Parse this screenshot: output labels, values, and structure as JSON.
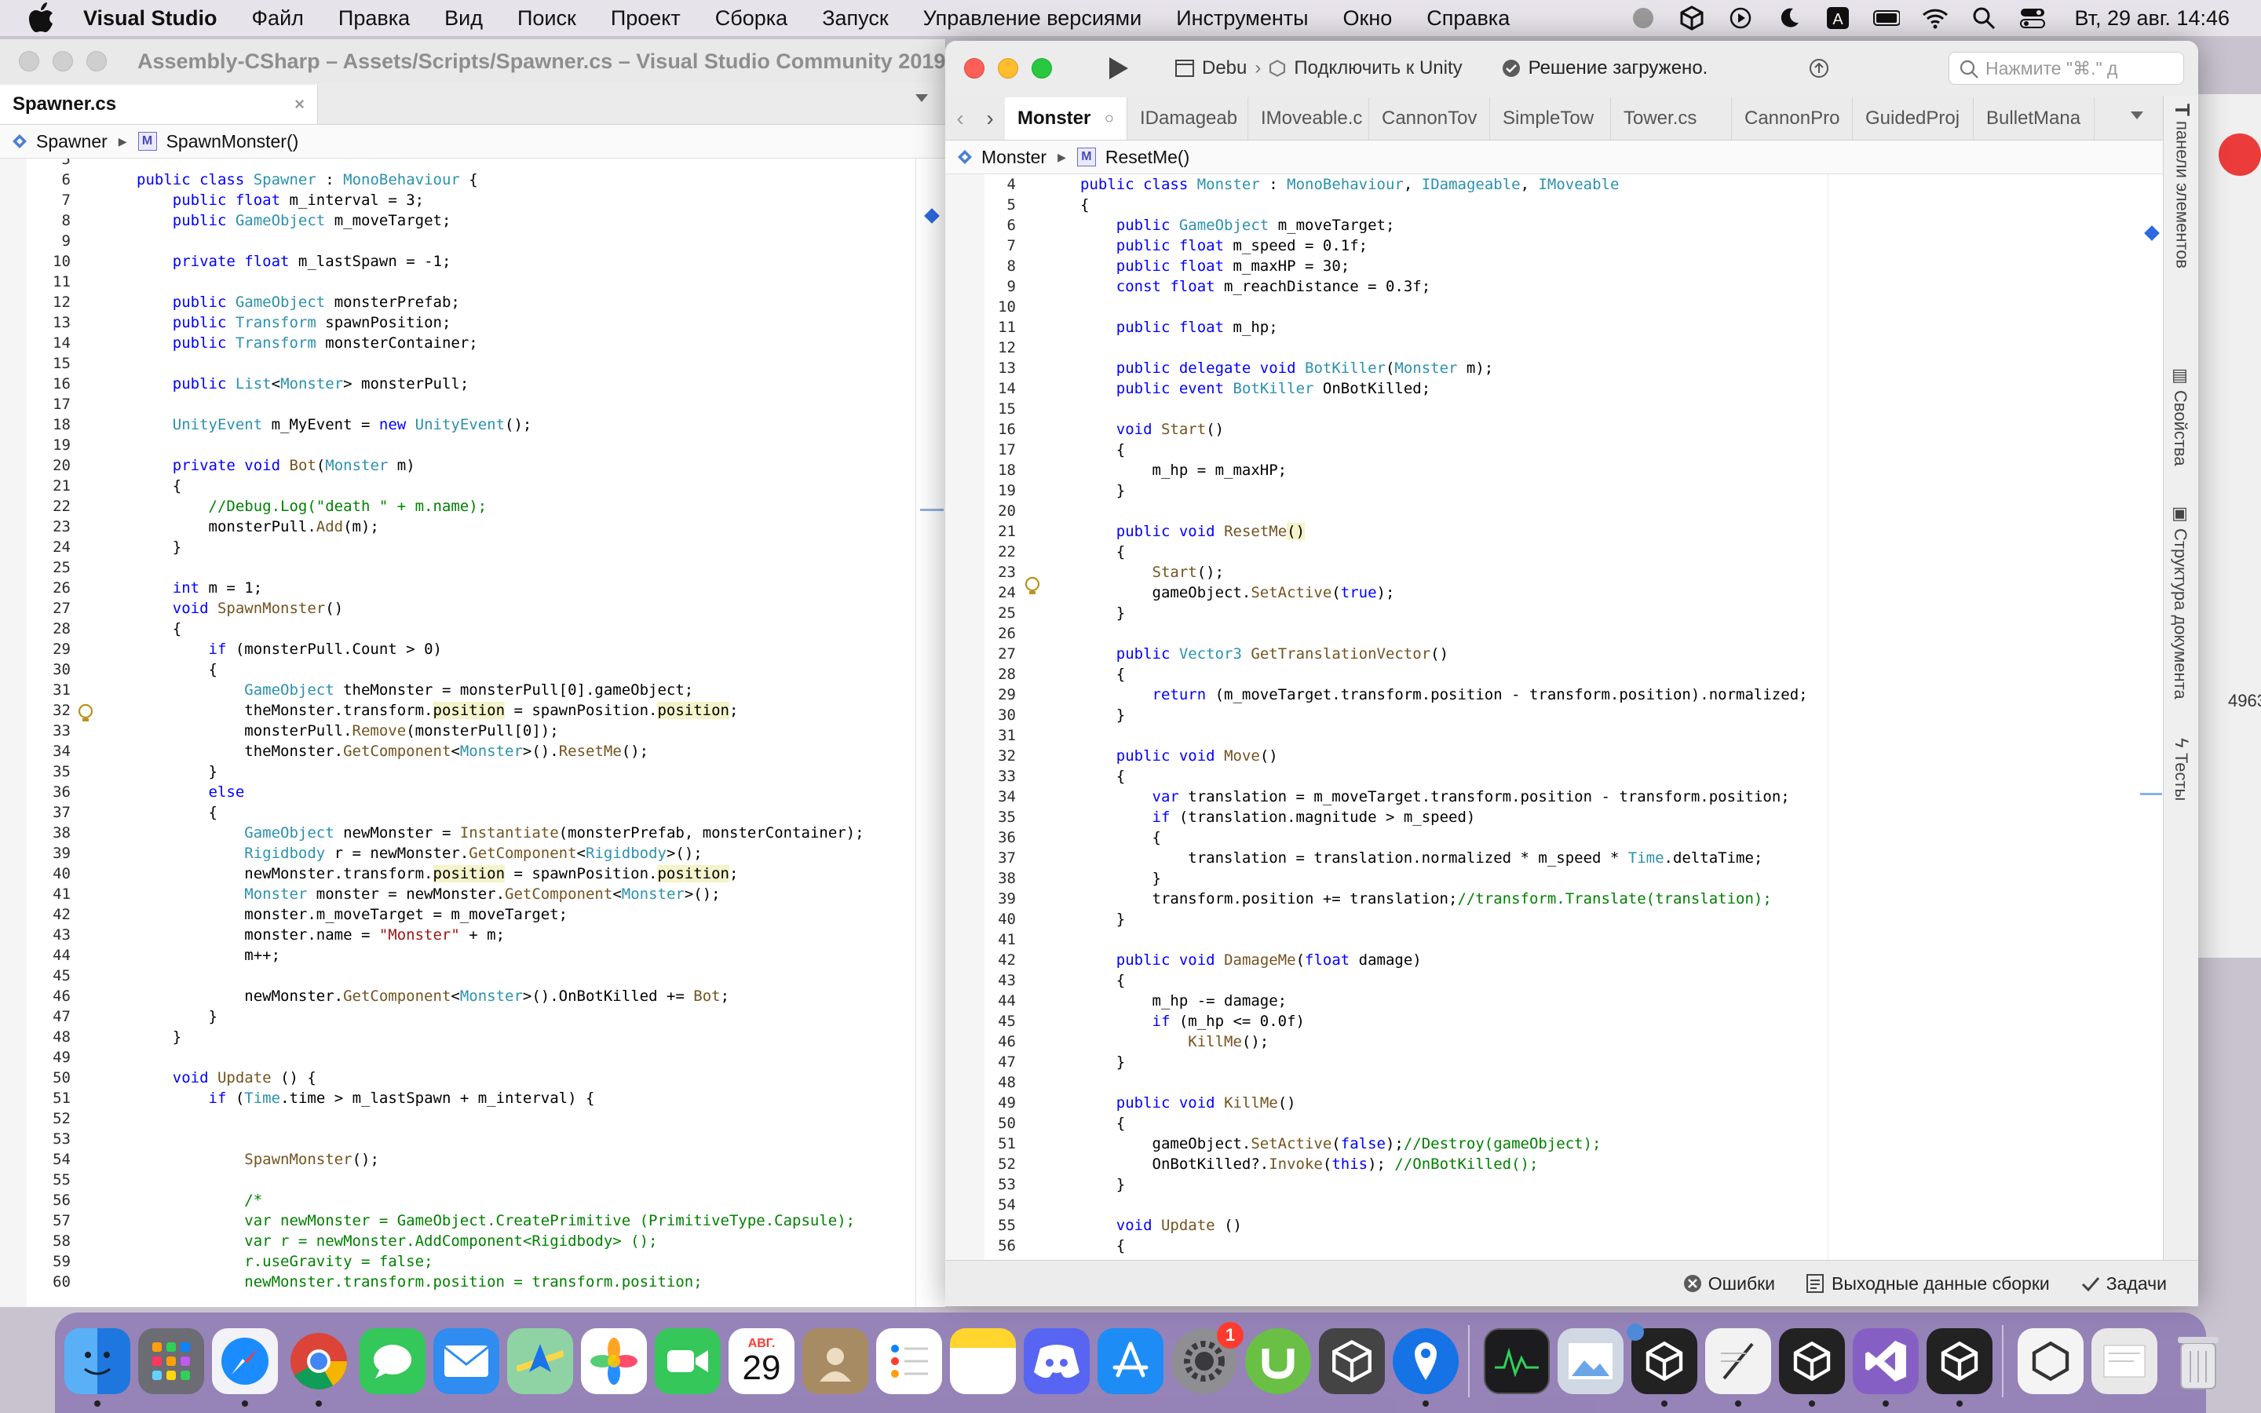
{
  "menubar": {
    "app_name": "Visual Studio",
    "items": [
      "Файл",
      "Правка",
      "Вид",
      "Поиск",
      "Проект",
      "Сборка",
      "Запуск",
      "Управление версиями",
      "Инструменты",
      "Окно",
      "Справка"
    ],
    "clock": "Вт, 29 авг.  14:46"
  },
  "left_window": {
    "title": "Assembly-CSharp – Assets/Scripts/Spawner.cs – Visual Studio Community 2019...",
    "tab_label": "Spawner.cs",
    "tab_close": "×",
    "breadcrumb_class": "Spawner",
    "breadcrumb_method": "SpawnMonster()",
    "method_badge": "M"
  },
  "right_window": {
    "config_label": "Debu",
    "connect_label": "Подключить к Unity",
    "status_label": "Решение загружено.",
    "search_placeholder": "Нажмите \"⌘.\" д",
    "tabs": [
      "Monster",
      "IDamageab",
      "IMoveable.c",
      "CannonTov",
      "SimpleTow",
      "Tower.cs",
      "CannonPro",
      "GuidedProj",
      "BulletMana"
    ],
    "breadcrumb_class": "Monster",
    "breadcrumb_method": "ResetMe()",
    "method_badge": "M",
    "side_panels": [
      "панели элементов",
      "Свойства",
      "Структура документа",
      "Тесты"
    ],
    "bottom": {
      "errors": "Ошибки",
      "build_output": "Выходные данные сборки",
      "tasks": "Задачи"
    }
  },
  "dock": {
    "calendar_month": "АВГ.",
    "calendar_day": "29",
    "settings_badge": "1"
  },
  "colors": {
    "keyword": "#0000ff",
    "type": "#2b91af",
    "method": "#74531f",
    "string": "#a31515",
    "comment": "#008000"
  }
}
